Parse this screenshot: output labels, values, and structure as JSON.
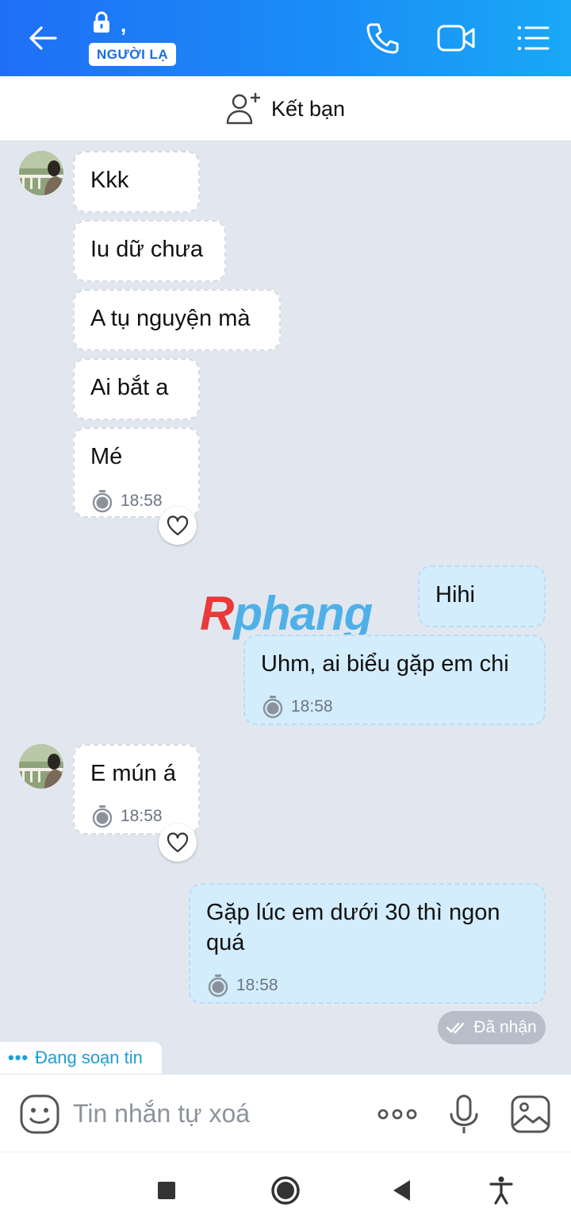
{
  "header": {
    "title": ",",
    "badge": "NGƯỜI LẠ",
    "accent": "#1a8cf7"
  },
  "add_friend": {
    "label": "Kết bạn"
  },
  "messages": [
    {
      "side": "in",
      "text": "Kkk"
    },
    {
      "side": "in",
      "text": "Iu dữ chưa"
    },
    {
      "side": "in",
      "text": "A tụ nguyện mà"
    },
    {
      "side": "in",
      "text": "Ai bắt a"
    },
    {
      "side": "in",
      "text": "Mé",
      "time": "18:58"
    },
    {
      "side": "out",
      "text": "Hihi"
    },
    {
      "side": "out",
      "text": "Uhm, ai biểu gặp em chi",
      "time": "18:58"
    },
    {
      "side": "in",
      "text": "E mún á",
      "time": "18:58"
    },
    {
      "side": "out",
      "text": "Gặp lúc em dưới 30 thì ngon quá",
      "time": "18:58"
    }
  ],
  "watermark": {
    "first": "R",
    "rest": "phang"
  },
  "status": {
    "received": "Đã nhận"
  },
  "typing": {
    "text": "Đang soạn tin"
  },
  "composer": {
    "placeholder": "Tin nhắn tự xoá"
  },
  "icons": {
    "header": [
      "back-arrow-icon",
      "lock-icon",
      "phone-icon",
      "video-camera-icon",
      "list-menu-icon"
    ],
    "composer": [
      "emoji-icon",
      "more-dots-icon",
      "microphone-icon",
      "image-icon"
    ],
    "nav": [
      "square-stop-icon",
      "home-circle-icon",
      "back-triangle-icon",
      "accessibility-icon"
    ]
  }
}
